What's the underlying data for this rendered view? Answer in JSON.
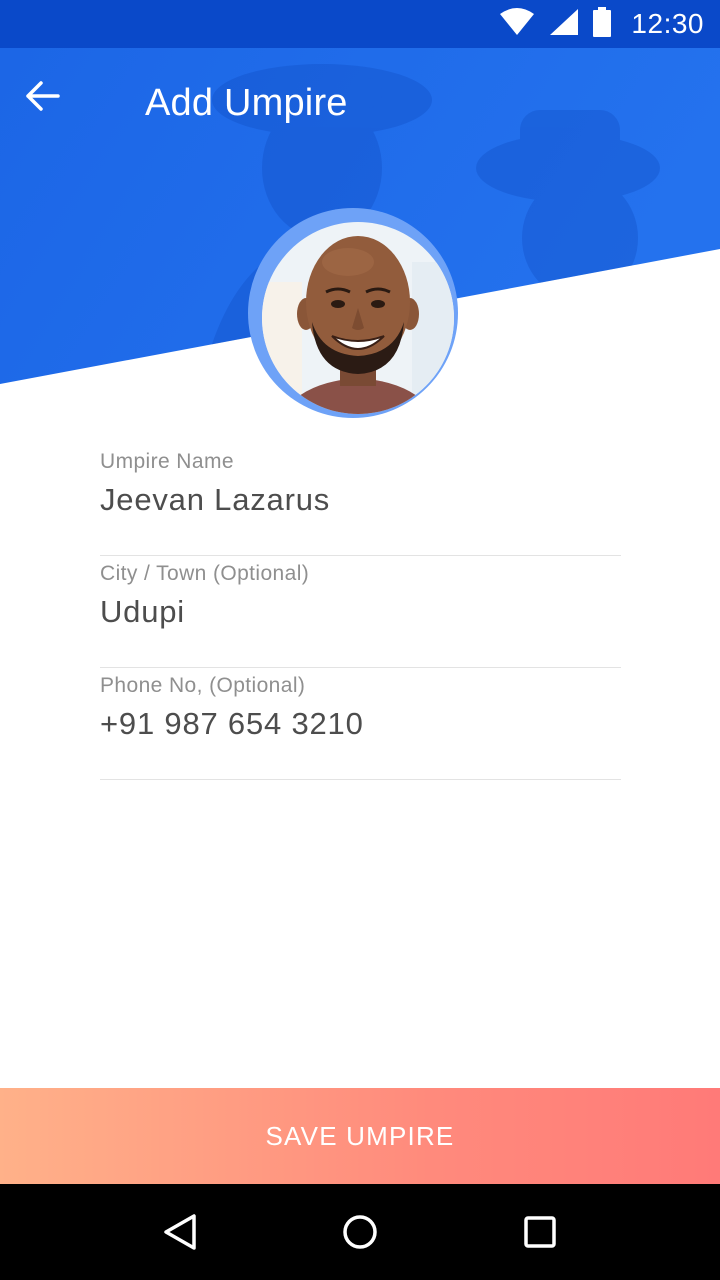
{
  "status_bar": {
    "time": "12:30",
    "icons": [
      "wifi-icon",
      "signal-icon",
      "battery-icon"
    ]
  },
  "header": {
    "title": "Add Umpire",
    "back_icon": "arrow-left-icon",
    "background_color": "#1f6ae8",
    "background_image": "umpires-photo"
  },
  "avatar": {
    "icon": "profile-photo"
  },
  "form": {
    "fields": [
      {
        "label": "Umpire Name",
        "value": "Jeevan Lazarus"
      },
      {
        "label": "City / Town (Optional)",
        "value": "Udupi"
      },
      {
        "label": "Phone No, (Optional)",
        "value": "+91 987 654 3210"
      }
    ]
  },
  "actions": {
    "save_label": "SAVE UMPIRE",
    "gradient_start": "#ffb189",
    "gradient_end": "#ff7a78"
  },
  "nav_bar": {
    "buttons": [
      "back-triangle-icon",
      "home-circle-icon",
      "recents-square-icon"
    ]
  }
}
